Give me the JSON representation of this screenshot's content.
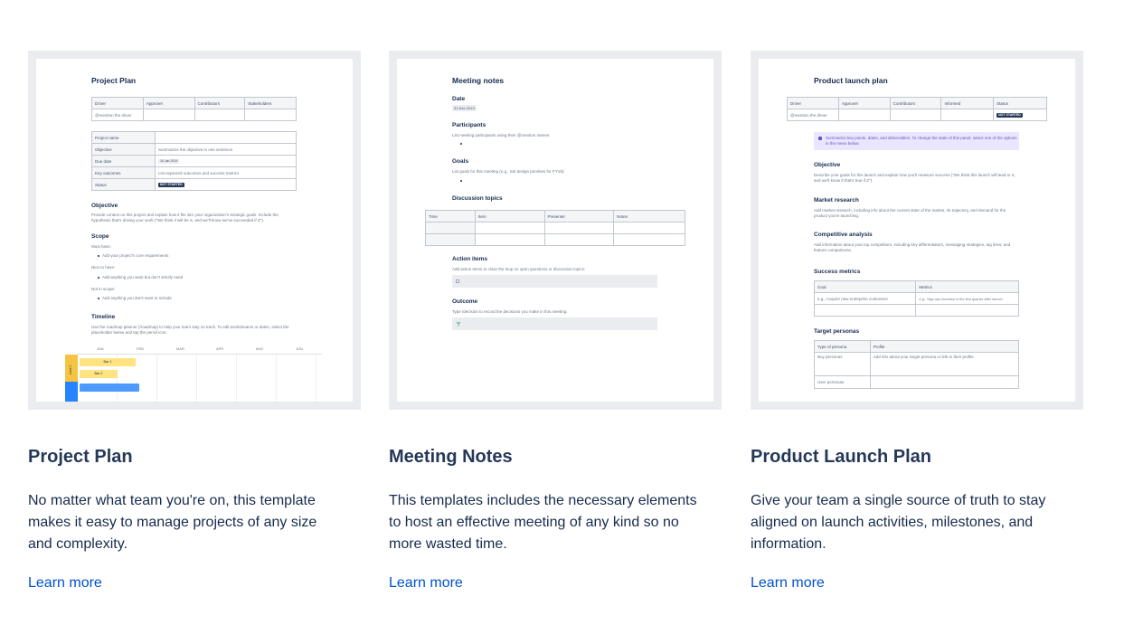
{
  "cards": [
    {
      "title": "Project Plan",
      "description": "No matter what team you're on, this template makes it easy to manage projects of any size and complexity.",
      "link": "Learn more",
      "preview": {
        "doc_title": "Project Plan",
        "roles_header": [
          "Driver",
          "Approver",
          "Contributors",
          "Stakeholders"
        ],
        "roles_row": [
          "@mention the driver",
          "",
          "",
          ""
        ],
        "info_rows": [
          [
            "Project name",
            ""
          ],
          [
            "Objective",
            "Summarize the objective in one sentence"
          ],
          [
            "Due date",
            "16 Jan 2019"
          ],
          [
            "Key outcomes",
            "List expected outcomes and success metrics"
          ],
          [
            "Status",
            "NOT STARTED"
          ]
        ],
        "objective_h": "Objective",
        "objective_t1": "Provide context on this project and explain how it fits into your organization's strategic goals. Include the",
        "objective_t2": "hypothesis that's driving your work (\"We think it will be X, and we'll know we've succeeded if Z\").",
        "scope_h": "Scope",
        "must_have": "Must have:",
        "must_item": "Add your project's core requirements",
        "nice_have": "Nice to have:",
        "nice_item": "Add anything you want but don't strictly need",
        "not_scope": "Not in scope:",
        "not_item": "Add anything you don't want to include",
        "timeline_h": "Timeline",
        "timeline_t1": "Use the roadmap planner (/roadmap) to help your team stay on track. To edit workstreams or dates, select the",
        "timeline_t2": "placeholder below and tap the pencil icon.",
        "months": [
          "JAN",
          "FEB",
          "MAR",
          "APR",
          "MAY",
          "JUN"
        ],
        "lane": "Lane 1",
        "bars": [
          "Bar 1",
          "Bar 2"
        ]
      }
    },
    {
      "title": "Meeting Notes",
      "description": "This templates includes the necessary elements to host an effective meeting of any kind so no more wasted time.",
      "link": "Learn more",
      "preview": {
        "doc_title": "Meeting notes",
        "date_h": "Date",
        "date_v": "31 Dec 2019",
        "participants_h": "Participants",
        "participants_t": "List meeting participants using their @mention names:",
        "goals_h": "Goals",
        "goals_t": "List goals for this meeting (e.g., Set design priorities for FY19):",
        "topics_h": "Discussion topics",
        "topics_header": [
          "Time",
          "Item",
          "Presenter",
          "Notes"
        ],
        "action_h": "Action items",
        "action_t": "Add action items to close the loop on open questions or discussion topics:",
        "outcome_h": "Outcome",
        "outcome_t": "Type /decision to record the decisions you make in this meeting:"
      }
    },
    {
      "title": "Product Launch Plan",
      "description": "Give your team a single source of truth to stay aligned on launch activities, milestones, and information.",
      "link": "Learn more",
      "preview": {
        "doc_title": "Product launch plan",
        "roles_header": [
          "Driver",
          "Approver",
          "Contributors",
          "Informed",
          "Status"
        ],
        "roles_row": [
          "@mention the driver",
          "",
          "",
          "",
          "NOT STARTED"
        ],
        "panel_t1": "Summarize key points, dates, and deliverables. To change the state of this panel, select one of the options",
        "panel_t2": "in the menu below.",
        "objective_h": "Objective",
        "objective_t1": "Describe your goals for this launch and explain how you'll measure success (\"We think this launch will lead to X,",
        "objective_t2": "and we'll know if that's true if Z\").",
        "market_h": "Market research",
        "market_t1": "Add market research, including info about the current state of the market, its trajectory, and demand for the",
        "market_t2": "product you're launching.",
        "comp_h": "Competitive analysis",
        "comp_t1": "Add information about your top competitors, including key differentiators, messaging strategies, tag lines, and",
        "comp_t2": "feature comparisons.",
        "success_h": "Success metrics",
        "success_header": [
          "Goal",
          "Metrics"
        ],
        "success_row": [
          "e.g., Acquire new enterprise customers",
          "e.g., Sign ups increase in the first quarter after launch"
        ],
        "personas_h": "Target personas",
        "personas_header": [
          "Type of persona",
          "Profile"
        ],
        "personas_rows": [
          [
            "Buy personas",
            "Add info about your target persona or link to their profile"
          ],
          [
            "User personas",
            ""
          ]
        ]
      }
    }
  ]
}
